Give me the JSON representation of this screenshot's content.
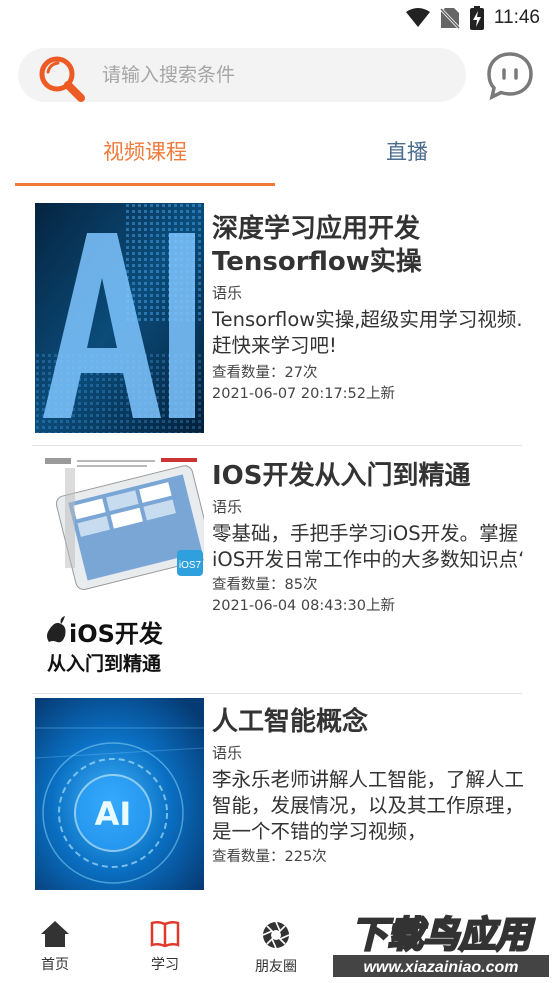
{
  "status_bar": {
    "time": "11:46"
  },
  "search": {
    "placeholder": "请输入搜索条件"
  },
  "tabs": [
    {
      "label": "视频课程",
      "active": true
    },
    {
      "label": "直播",
      "active": false
    }
  ],
  "courses": [
    {
      "title": "深度学习应用开发Tensorflow实操",
      "category": "语乐",
      "description": "Tensorflow实操,超级实用学习视频.赶快来学习吧!",
      "views": "查看数量：27次",
      "updated": "2021-06-07 20:17:52上新",
      "thumb_text": "AI"
    },
    {
      "title": "IOS开发从入门到精通",
      "category": "语乐",
      "description": "零基础，手把手学习iOS开发。掌握iOS开发日常工作中的大多数知识点‘",
      "views": "查看数量：85次",
      "updated": "2021-06-04 08:43:30上新",
      "thumb_text": "iOS开发",
      "thumb_subtext": "从入门到精通",
      "thumb_badge": "iOS7"
    },
    {
      "title": "人工智能概念",
      "category": "语乐",
      "description": "李永乐老师讲解人工智能，了解人工智能，发展情况，以及其工作原理，是一个不错的学习视频，",
      "views": "查看数量：225次",
      "thumb_text": "AI"
    }
  ],
  "bottom_nav": [
    {
      "label": "首页",
      "icon": "home-icon"
    },
    {
      "label": "学习",
      "icon": "book-icon",
      "active": true
    },
    {
      "label": "朋友圈",
      "icon": "aperture-icon"
    }
  ],
  "watermark": {
    "text": "下载鸟应用",
    "url": "www.xiazainiao.com"
  },
  "colors": {
    "accent": "#f07a3a",
    "tab_inactive": "#4b6d8f"
  }
}
